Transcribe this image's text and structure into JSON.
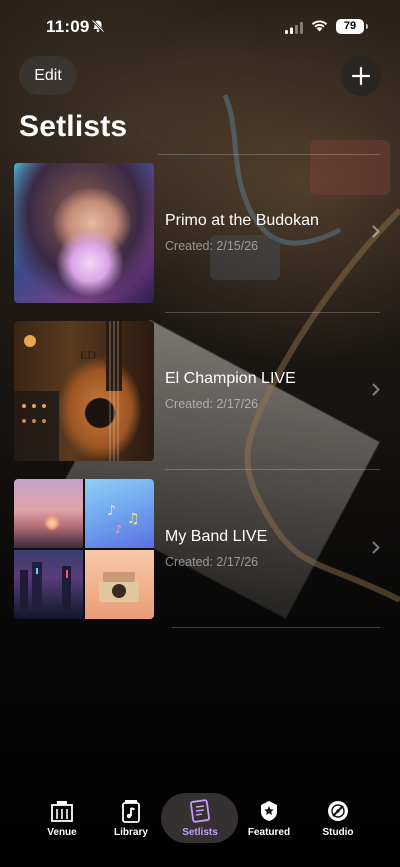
{
  "status_bar": {
    "time": "11:09",
    "battery": "79",
    "icons": [
      "bell-slash-icon",
      "cell-signal-icon",
      "wifi-icon",
      "battery-icon"
    ]
  },
  "header": {
    "edit_label": "Edit",
    "add_icon": "plus-icon",
    "title": "Setlists"
  },
  "setlists": [
    {
      "title": "Primo at the Budokan",
      "subtitle": "Created: 2/15/26"
    },
    {
      "title": "El Champion LIVE",
      "subtitle": "Created: 2/17/26"
    },
    {
      "title": "My Band LIVE",
      "subtitle": "Created: 2/17/26"
    }
  ],
  "tabbar": {
    "active": "Setlists",
    "tabs": [
      {
        "label": "Venue",
        "icon": "venue-building-icon"
      },
      {
        "label": "Library",
        "icon": "library-music-note-icon"
      },
      {
        "label": "Setlists",
        "icon": "setlists-document-icon"
      },
      {
        "label": "Featured",
        "icon": "featured-star-badge-icon"
      },
      {
        "label": "Studio",
        "icon": "studio-record-icon"
      }
    ]
  },
  "colors": {
    "accent": "#c89bff",
    "background": "#000000",
    "text": "#ffffff"
  }
}
